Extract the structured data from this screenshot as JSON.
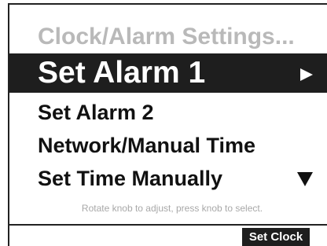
{
  "header": {
    "title": "Clock/Alarm Settings..."
  },
  "menu": {
    "items": [
      {
        "label": "Set Alarm 1",
        "selected": true
      },
      {
        "label": "Set Alarm 2",
        "selected": false
      },
      {
        "label": "Network/Manual Time",
        "selected": false
      },
      {
        "label": "Set Time Manually",
        "selected": false
      }
    ],
    "selected_indicator_icon": "triangle-right-icon",
    "more_indicator_icon": "triangle-down-icon"
  },
  "hint": {
    "text": "Rotate knob to adjust, press knob to select."
  },
  "softkeys": {
    "right_label": "Set Clock"
  },
  "colors": {
    "background": "#ffffff",
    "highlight": "#1e1e1e",
    "title_gray": "#b9b9b9",
    "hint_gray": "#a8a8a8"
  }
}
